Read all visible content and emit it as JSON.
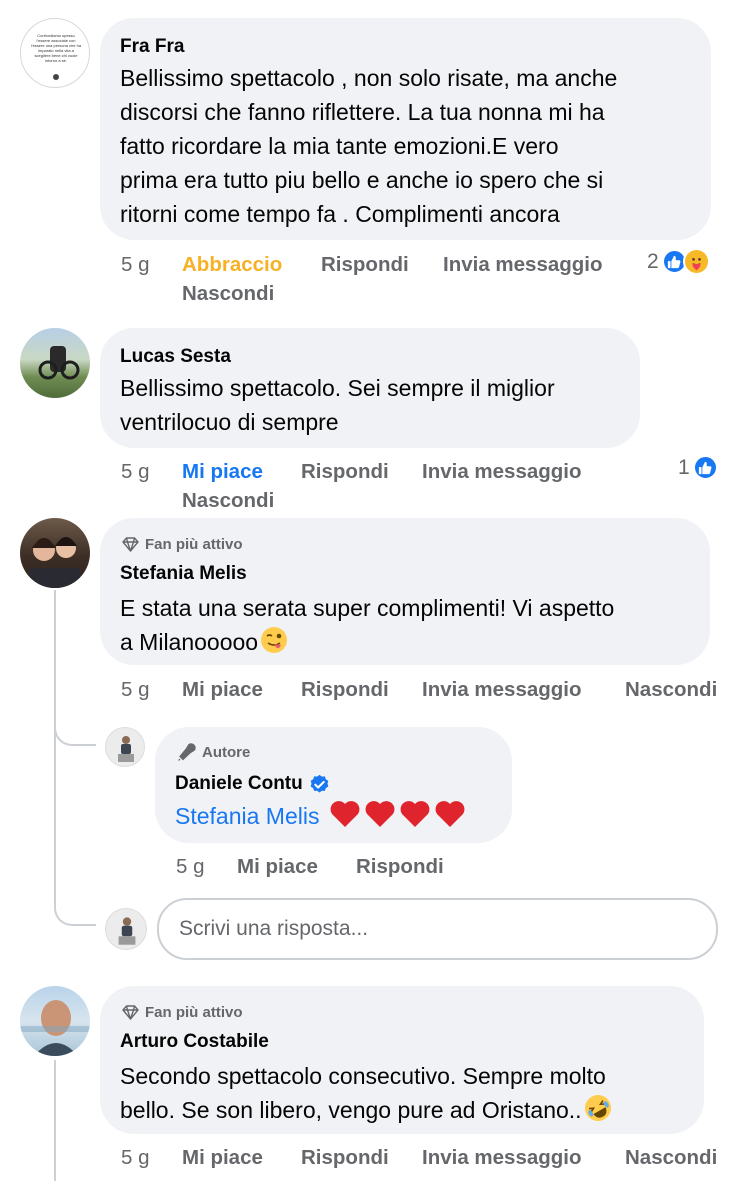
{
  "comments": [
    {
      "author": "Fra Fra",
      "avatar_text": "Confondiamo spesso l'essere associale con l'essere una persona che ha imparato nella vita a scegliere bene chi vuole intorno a sé.",
      "lines": [
        "Bellissimo spettacolo , non solo risate, ma anche",
        "discorsi che fanno riflettere.  La tua nonna  mi ha",
        "fatto  ricordare la mia tante emozioni.E vero",
        "prima era tutto piu bello e anche io spero che si",
        "ritorni come tempo fa . Complimenti ancora"
      ],
      "time": "5 g",
      "reaction_label": "Abbraccio",
      "reply": "Rispondi",
      "message": "Invia messaggio",
      "hide": "Nascondi",
      "reaction_count": "2",
      "reaction_icons": [
        "like-icon",
        "care-icon"
      ]
    },
    {
      "author": "Lucas Sesta",
      "lines": [
        "Bellissimo spettacolo. Sei sempre il miglior",
        "ventrilocuo di sempre"
      ],
      "time": "5 g",
      "reaction_label": "Mi piace",
      "reply": "Rispondi",
      "message": "Invia messaggio",
      "hide": "Nascondi",
      "reaction_count": "1",
      "reaction_icons": [
        "like-icon"
      ]
    },
    {
      "badge": "Fan più attivo",
      "author": "Stefania Melis",
      "lines": [
        "E stata una serata super complimenti! Vi aspetto",
        "a Milanooooo"
      ],
      "emoji": "winking-face-with-tongue-icon",
      "time": "5 g",
      "reaction_label": "Mi piace",
      "reply": "Rispondi",
      "message": "Invia messaggio",
      "hide": "Nascondi",
      "replies": [
        {
          "badge": "Autore",
          "author": "Daniele Contu",
          "verified": true,
          "mention": "Stefania Melis",
          "hearts": 4,
          "time": "5 g",
          "reaction_label": "Mi piace",
          "reply": "Rispondi"
        }
      ],
      "reply_placeholder": "Scrivi una risposta..."
    },
    {
      "badge": "Fan più attivo",
      "author": "Arturo Costabile",
      "lines": [
        "Secondo spettacolo consecutivo. Sempre molto",
        "bello. Se son libero, vengo pure ad Oristano.."
      ],
      "emoji": "rolling-on-floor-laughing-icon",
      "time": "5 g",
      "reaction_label": "Mi piace",
      "reply": "Rispondi",
      "message": "Invia messaggio",
      "hide": "Nascondi"
    }
  ],
  "colors": {
    "bubble": "#f0f2f5",
    "secondary_text": "#65676b",
    "link_blue": "#1877f2",
    "hug_gold": "#f7b125",
    "heart_red": "#e0242e"
  }
}
